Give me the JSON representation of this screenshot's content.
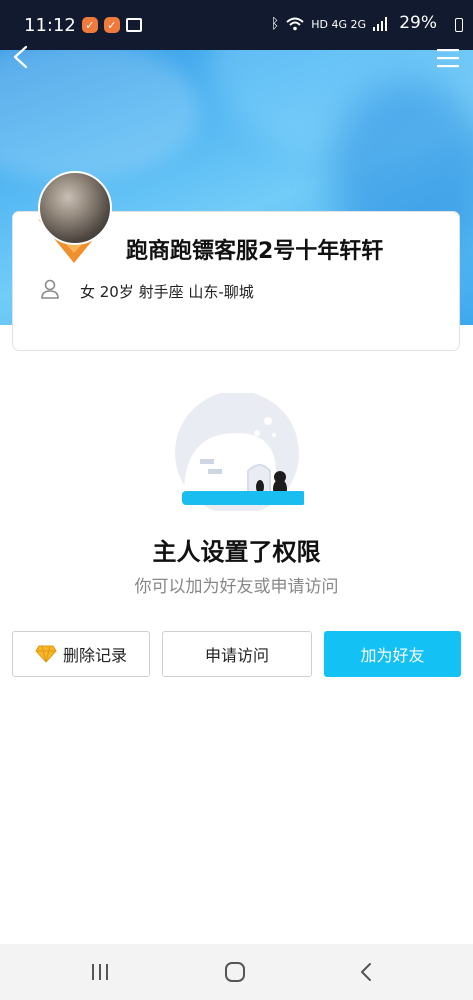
{
  "status_bar": {
    "time": "11:12",
    "network": "HD 4G 2G",
    "battery": "29%"
  },
  "profile": {
    "nickname": "跑商跑镖客服2号十年轩轩",
    "info": "女 20岁 射手座 山东-聊城"
  },
  "permission": {
    "title": "主人设置了权限",
    "subtitle": "你可以加为好友或申请访问"
  },
  "actions": {
    "delete_label": "删除记录",
    "visit_label": "申请访问",
    "add_label": "加为好友"
  },
  "colors": {
    "accent": "#13c1f4",
    "hero": "#4fb4f2",
    "avatar_tag": "#f0902c"
  },
  "icons": [
    "back-arrow-icon",
    "menu-icon",
    "user-icon",
    "diamond-icon",
    "nav-recent-icon",
    "nav-home-icon",
    "nav-back-icon"
  ]
}
